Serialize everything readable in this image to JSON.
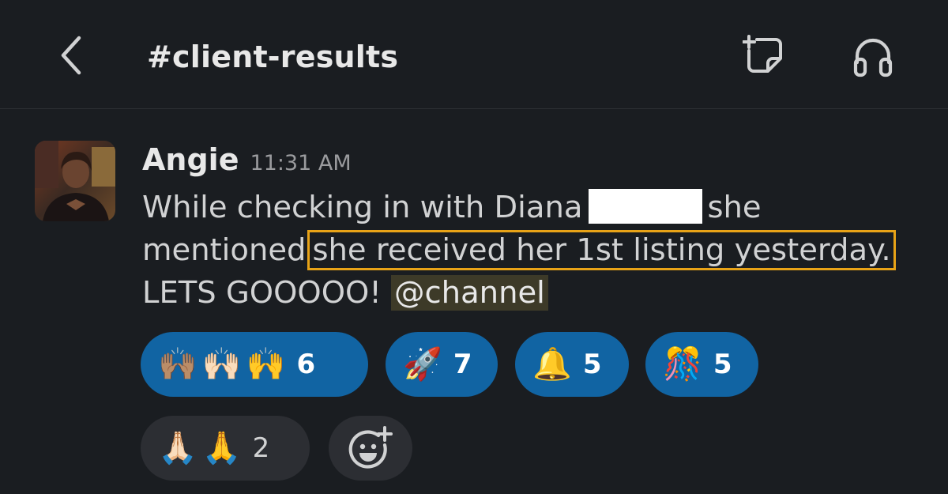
{
  "header": {
    "channel_name": "#client-results"
  },
  "message": {
    "author": "Angie",
    "timestamp": "11:31 AM",
    "text_part1": "While checking in with Diana",
    "text_part2": "she mentioned",
    "highlighted_text": "she received her 1st listing yesterday.",
    "text_part3": "LETS GOOOOO!",
    "mention": "@channel"
  },
  "reactions": [
    {
      "emojis": [
        "🙌🏽",
        "🙌🏻",
        "🙌"
      ],
      "count": "6"
    },
    {
      "emojis": [
        "🚀"
      ],
      "count": "7"
    },
    {
      "emojis": [
        "🔔"
      ],
      "count": "5"
    },
    {
      "emojis": [
        "🎊"
      ],
      "count": "5"
    },
    {
      "emojis": [
        "🙏🏻",
        "🙏"
      ],
      "count": "2"
    }
  ],
  "colors": {
    "background": "#1a1d21",
    "reaction_active": "#1164a3",
    "reaction_neutral": "#2c2e33",
    "highlight_border": "#e8a317",
    "mention_bg": "#3d3a28"
  }
}
